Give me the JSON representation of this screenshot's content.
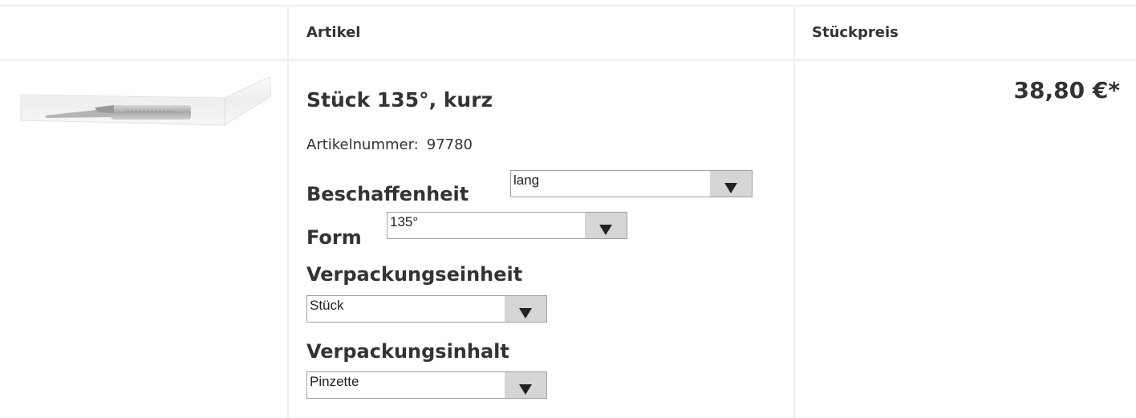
{
  "table": {
    "headers": {
      "article": "Artikel",
      "unit_price": "Stückpreis"
    }
  },
  "product": {
    "image_icon": "tweezers-product-photo",
    "title": "Stück 135°, kurz",
    "article_number_label": "Artikelnummer:",
    "article_number": "97780",
    "price": "38,80 €*",
    "options": [
      {
        "label": "Beschaffenheit",
        "selected": "lang"
      },
      {
        "label": "Form",
        "selected": "135°"
      },
      {
        "label": "Verpackungseinheit",
        "selected": "Stück"
      },
      {
        "label": "Verpackungsinhalt",
        "selected": "Pinzette"
      }
    ]
  },
  "colors": {
    "text": "#333333",
    "grid": "#f0f0f0",
    "select_button": "#d6d6d6",
    "select_border": "#a0a0a0"
  }
}
